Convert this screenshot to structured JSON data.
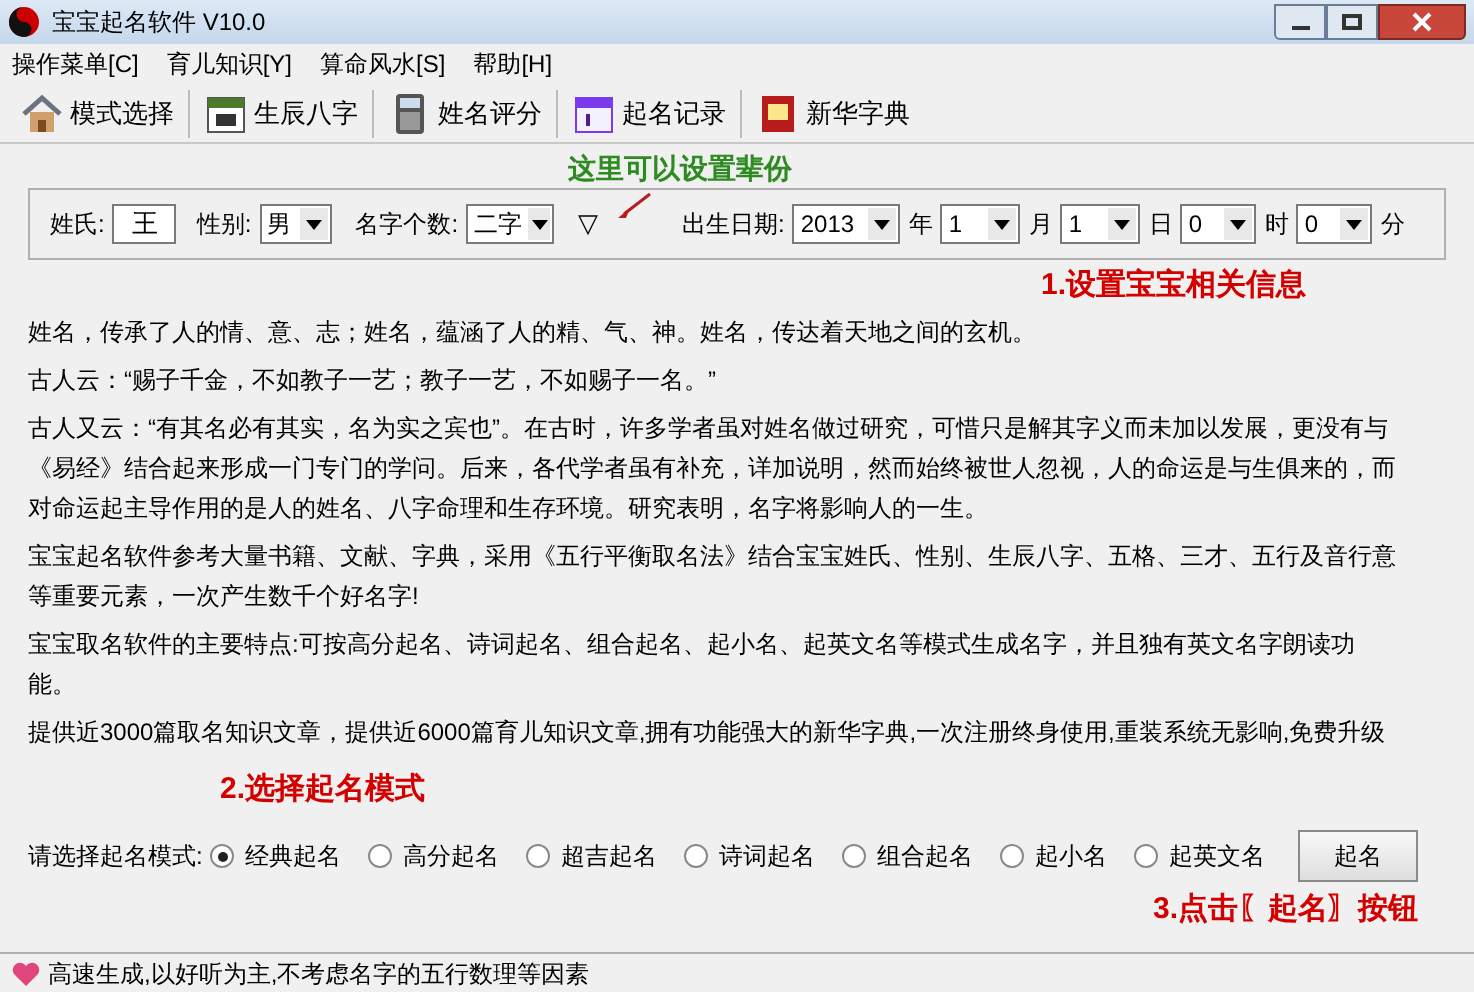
{
  "window": {
    "title": "宝宝起名软件 V10.0"
  },
  "menu": [
    "操作菜单[C]",
    "育儿知识[Y]",
    "算命风水[S]",
    "帮助[H]"
  ],
  "toolbar": [
    {
      "label": "模式选择",
      "kind": "home"
    },
    {
      "label": "生辰八字",
      "kind": "calendar"
    },
    {
      "label": "姓名评分",
      "kind": "calculator"
    },
    {
      "label": "起名记录",
      "kind": "notebook"
    },
    {
      "label": "新华字典",
      "kind": "dictionary"
    }
  ],
  "info": {
    "surname_label": "姓氏:",
    "surname": "王",
    "gender_label": "性别:",
    "gender": "男",
    "count_label": "名字个数:",
    "count": "二字",
    "generation_marker": "▽",
    "birth_label": "出生日期:",
    "year": "2013",
    "year_unit": "年",
    "month": "1",
    "month_unit": "月",
    "day": "1",
    "day_unit": "日",
    "hour": "0",
    "hour_unit": "时",
    "minute": "0",
    "minute_unit": "分"
  },
  "annotations": {
    "generation": "这里可以设置辈份",
    "step1": "1.设置宝宝相关信息",
    "step2": "2.选择起名模式",
    "step3": "3.点击〖起名〗按钮"
  },
  "paragraphs": [
    "姓名，传承了人的情、意、志；姓名，蕴涵了人的精、气、神。姓名，传达着天地之间的玄机。",
    "古人云：“赐子千金，不如教子一艺；教子一艺，不如赐子一名。”",
    "古人又云：“有其名必有其实，名为实之宾也”。在古时，许多学者虽对姓名做过研究，可惜只是解其字义而未加以发展，更没有与《易经》结合起来形成一门专门的学问。后来，各代学者虽有补充，详加说明，然而始终被世人忽视，人的命运是与生俱来的，而对命运起主导作用的是人的姓名、八字命理和生存环境。研究表明，名字将影响人的一生。",
    "宝宝起名软件参考大量书籍、文献、字典，采用《五行平衡取名法》结合宝宝姓氏、性别、生辰八字、五格、三才、五行及音行意等重要元素，一次产生数千个好名字!",
    "宝宝取名软件的主要特点:可按高分起名、诗词起名、组合起名、起小名、起英文名等模式生成名字，并且独有英文名字朗读功能。",
    "提供近3000篇取名知识文章，提供近6000篇育儿知识文章,拥有功能强大的新华字典,一次注册终身使用,重装系统无影响,免费升级"
  ],
  "mode_label": "请选择起名模式:",
  "modes": [
    {
      "label": "经典起名",
      "selected": true
    },
    {
      "label": "高分起名",
      "selected": false
    },
    {
      "label": "超吉起名",
      "selected": false
    },
    {
      "label": "诗词起名",
      "selected": false
    },
    {
      "label": "组合起名",
      "selected": false
    },
    {
      "label": "起小名",
      "selected": false
    },
    {
      "label": "起英文名",
      "selected": false
    }
  ],
  "generate_button": "起名",
  "status_bar": "高速生成,以好听为主,不考虑名字的五行数理等因素"
}
